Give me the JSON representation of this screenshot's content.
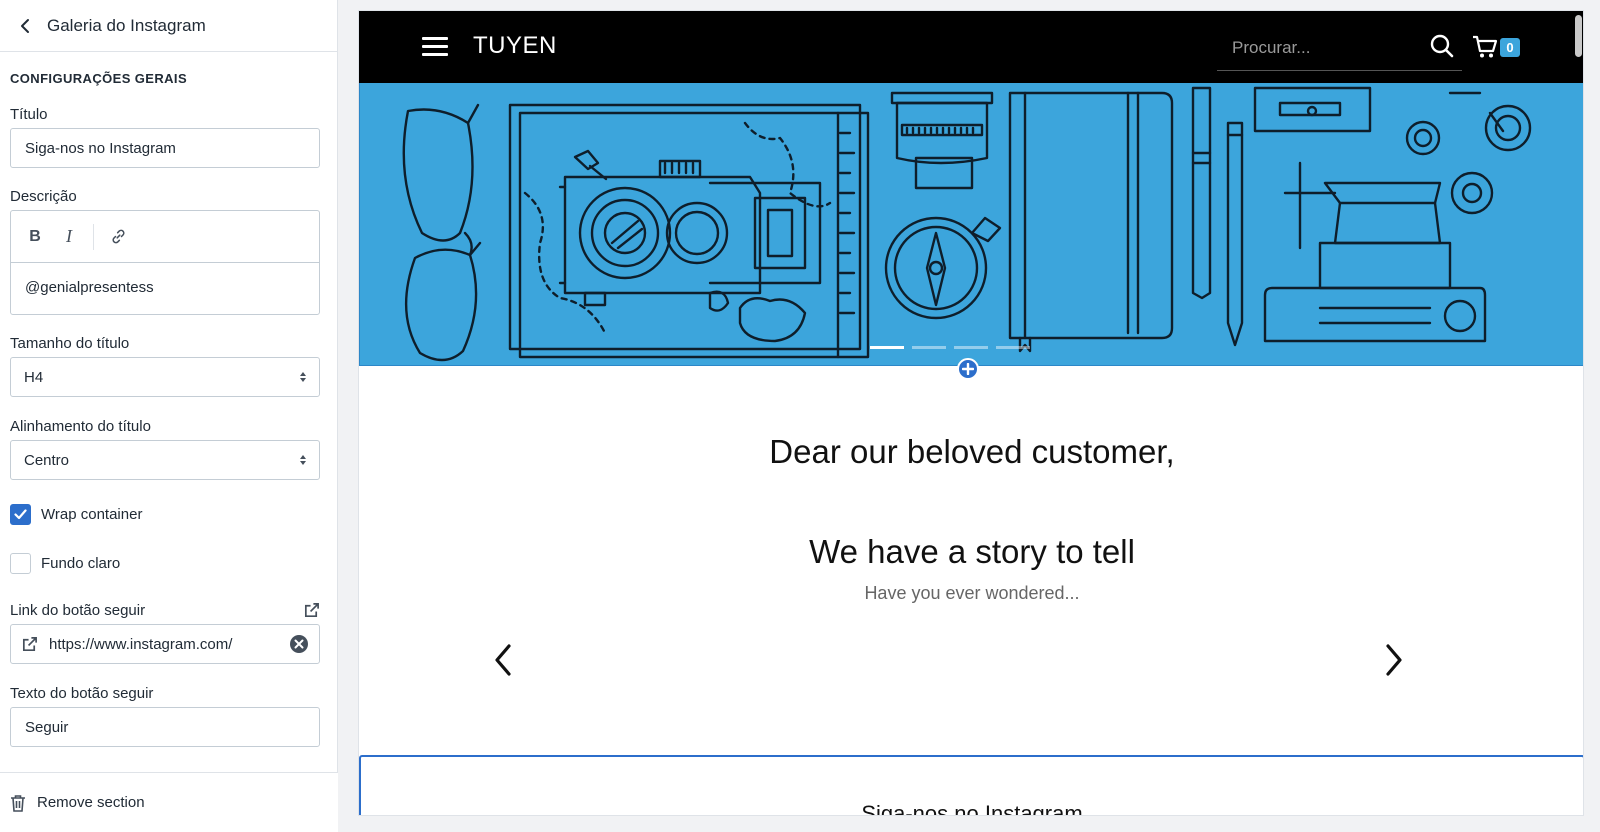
{
  "sidebar": {
    "title": "Galeria do Instagram",
    "section_heading": "CONFIGURAÇÕES GERAIS",
    "titulo": {
      "label": "Título",
      "value": "Siga-nos no Instagram"
    },
    "descricao": {
      "label": "Descrição",
      "toolbar": {
        "bold": "B",
        "italic": "I"
      },
      "value": "@genialpresentess"
    },
    "tamanho_titulo": {
      "label": "Tamanho do título",
      "value": "H4"
    },
    "alinhamento_titulo": {
      "label": "Alinhamento do título",
      "value": "Centro"
    },
    "wrap_container": {
      "label": "Wrap container",
      "checked": true
    },
    "fundo_claro": {
      "label": "Fundo claro",
      "checked": false
    },
    "link_botao": {
      "label": "Link do botão seguir",
      "value": "https://www.instagram.com/"
    },
    "texto_botao": {
      "label": "Texto do botão seguir",
      "value": "Seguir"
    },
    "remove_label": "Remove section"
  },
  "store": {
    "logo": "TUYEN",
    "search_placeholder": "Procurar...",
    "cart_count": "0"
  },
  "hero": {
    "slides": 4,
    "active_slide": 1
  },
  "story": {
    "greeting": "Dear our beloved customer,",
    "title": "We have a story to tell",
    "subtitle": "Have you ever wondered..."
  },
  "instagram": {
    "title": "Siga-nos no Instagram"
  },
  "colors": {
    "accent": "#2c6ecb",
    "hero_bg": "#3ca5dc",
    "header_bg": "#000000",
    "badge": "#3ca5dc"
  }
}
